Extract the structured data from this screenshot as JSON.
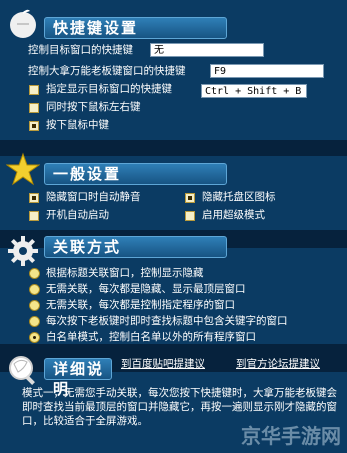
{
  "shortcuts": {
    "title": "快捷键设置",
    "target_window_label": "控制目标窗口的快捷键",
    "target_window_value": "无",
    "boss_key_label": "控制大拿万能老板键窗口的快捷键",
    "boss_key_value": "F9",
    "show_target_label": "指定显示目标窗口的快捷键",
    "show_target_value": "Ctrl + Shift + B",
    "right_click_label": "同时按下鼠标左右键",
    "middle_click_label": "按下鼠标中键"
  },
  "general": {
    "title": "一般设置",
    "mute_label": "隐藏窗口时自动静音",
    "tray_label": "隐藏托盘区图标",
    "autostart_label": "开机自动启动",
    "super_mode_label": "启用超级模式"
  },
  "association": {
    "title": "关联方式",
    "options": [
      "根据标题关联窗口，控制显示隐藏",
      "无需关联，每次都是隐藏、显示最顶层窗口",
      "无需关联，每次都是控制指定程序的窗口",
      "每次按下老板键时即时查找标题中包含关键字的窗口",
      "白名单模式，控制白名单以外的所有程序窗口"
    ]
  },
  "details": {
    "title": "详细说明",
    "baidu_link": "到百度贴吧提建议",
    "forum_link": "到官方论坛提建议",
    "text": "模式一，无需您手动关联，每次您按下快捷键时，大拿万能老板键会即时查找当前最顶层的窗口并隐藏它，再按一遍则显示刚才隐藏的窗口，比较适合于全屏游戏。"
  },
  "watermark": "京华手游网",
  "colors": {
    "background": "#06223d",
    "panel": "#0b3b63",
    "accent": "#2f7fb7"
  }
}
